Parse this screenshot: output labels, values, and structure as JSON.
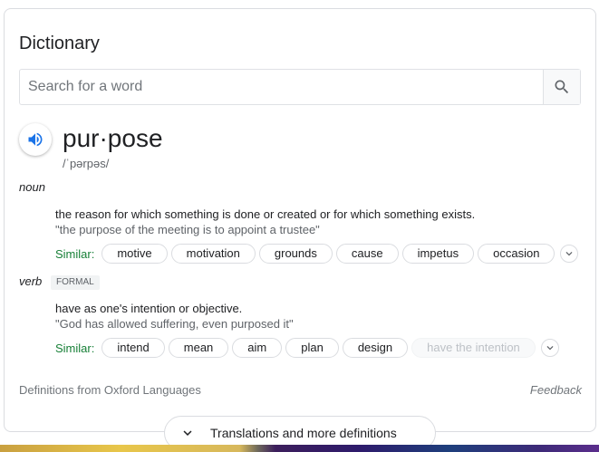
{
  "panel": {
    "title": "Dictionary",
    "search_placeholder": "Search for a word"
  },
  "entry": {
    "word": "pur·pose",
    "phonetic": "/ˈpərpəs/",
    "senses": [
      {
        "pos": "noun",
        "tag": "",
        "definition": "the reason for which something is done or created or for which something exists.",
        "example": "\"the purpose of the meeting is to appoint a trustee\"",
        "similar_label": "Similar:",
        "similar": [
          "motive",
          "motivation",
          "grounds",
          "cause",
          "impetus",
          "occasion"
        ]
      },
      {
        "pos": "verb",
        "tag": "FORMAL",
        "definition": "have as one's intention or objective.",
        "example": "\"God has allowed suffering, even purposed it\"",
        "similar_label": "Similar:",
        "similar": [
          "intend",
          "mean",
          "aim",
          "plan",
          "design",
          "have the intention"
        ]
      }
    ]
  },
  "footer": {
    "source": "Definitions from Oxford Languages",
    "feedback": "Feedback",
    "expand_label": "Translations and more definitions"
  },
  "colors": {
    "accent_blue": "#1a73e8",
    "similar_green": "#188038"
  },
  "icons": {
    "search": "search-icon",
    "speaker": "speaker-icon",
    "more": "chevron-down-icon"
  }
}
